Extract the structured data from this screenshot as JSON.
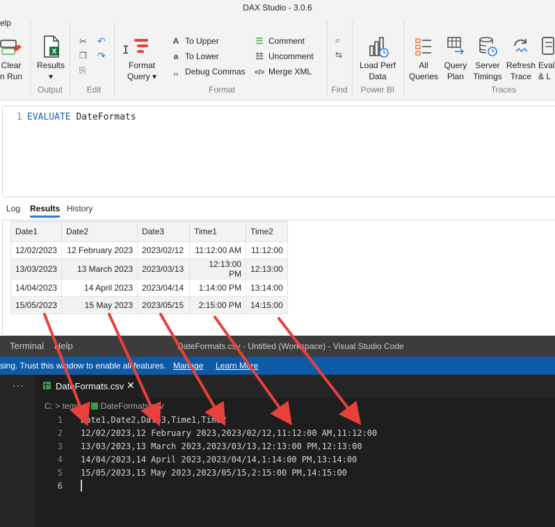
{
  "app": {
    "title": "DAX Studio - 3.0.6",
    "menu_fragment": "elp"
  },
  "ribbon": {
    "clear": {
      "line1": "Clear",
      "line2": "n Run"
    },
    "results": {
      "label": "Results",
      "arrow": "▾"
    },
    "format_query": {
      "line1": "Format",
      "line2": "Query ▾"
    },
    "to_upper": "To Upper",
    "to_lower": "To Lower",
    "debug_commas": "Debug Commas",
    "comment": "Comment",
    "uncomment": "Uncomment",
    "merge_xml": "Merge XML",
    "load_perf": {
      "line1": "Load Perf",
      "line2": "Data"
    },
    "all_queries": {
      "line1": "All",
      "line2": "Queries"
    },
    "query_plan": {
      "line1": "Query",
      "line2": "Plan"
    },
    "server_timings": {
      "line1": "Server",
      "line2": "Timings"
    },
    "refresh_trace": {
      "line1": "Refresh",
      "line2": "Trace"
    },
    "evaluate": {
      "line1": "Evalu",
      "line2": "& L"
    },
    "groups": {
      "output": "Output",
      "edit": "Edit",
      "format": "Format",
      "find": "Find",
      "powerbi": "Power BI",
      "traces": "Traces"
    }
  },
  "editor": {
    "line_number": "1",
    "keyword": "EVALUATE",
    "rest": " DateFormats"
  },
  "results_tabs": [
    "Log",
    "Results",
    "History"
  ],
  "grid": {
    "columns": [
      "Date1",
      "Date2",
      "Date3",
      "Time1",
      "Time2"
    ],
    "rows": [
      [
        "12/02/2023",
        "12 February 2023",
        "2023/02/12",
        "11:12:00 AM",
        "11:12:00"
      ],
      [
        "13/03/2023",
        "13 March 2023",
        "2023/03/13",
        "12:13:00 PM",
        "12:13:00"
      ],
      [
        "14/04/2023",
        "14 April 2023",
        "2023/04/14",
        "1:14:00 PM",
        "13:14:00"
      ],
      [
        "15/05/2023",
        "15 May 2023",
        "2023/05/15",
        "2:15:00 PM",
        "14:15:00"
      ]
    ]
  },
  "vscode": {
    "menu_terminal": "Terminal",
    "menu_help": "Help",
    "window_title": "DateFormats.csv - Untitled (Workspace) - Visual Studio Code",
    "banner_text": "sing. Trust this window to enable all features.",
    "banner_manage": "Manage",
    "banner_learn": "Learn More",
    "tab_name": "DateFormats.csv",
    "tab_close": "✕",
    "breadcrumb_path": "C: > temp >",
    "breadcrumb_file": "DateFormats.csv",
    "lines": [
      {
        "n": "1",
        "text": "Date1,Date2,Date3,Time1,Time2"
      },
      {
        "n": "2",
        "text": "12/02/2023,12 February 2023,2023/02/12,11:12:00 AM,11:12:00"
      },
      {
        "n": "3",
        "text": "13/03/2023,13 March 2023,2023/03/13,12:13:00 PM,12:13:00"
      },
      {
        "n": "4",
        "text": "14/04/2023,14 April 2023,2023/04/14,1:14:00 PM,13:14:00"
      },
      {
        "n": "5",
        "text": "15/05/2023,15 May 2023,2023/05/15,2:15:00 PM,14:15:00"
      },
      {
        "n": "6",
        "text": ""
      }
    ]
  },
  "colors": {
    "arrow": "#e8413c",
    "vscode_banner": "#0d5aa7",
    "accent_tab": "#2b7bd1",
    "keyword": "#1a5fb4"
  }
}
